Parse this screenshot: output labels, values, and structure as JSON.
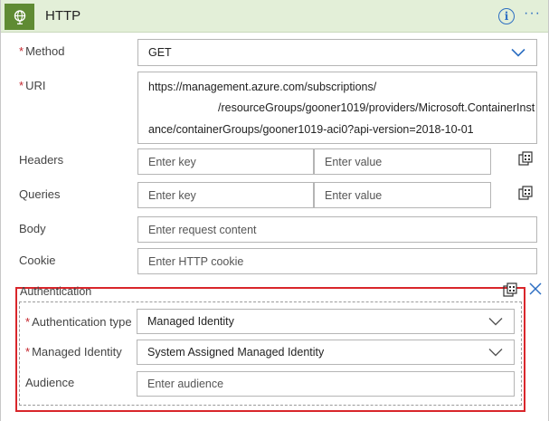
{
  "header": {
    "title": "HTTP",
    "info_glyph": "i",
    "more_glyph": "···",
    "icon": "globe-icon",
    "accent_color": "#5f8b33"
  },
  "form": {
    "method": {
      "label": "Method",
      "value": "GET"
    },
    "uri": {
      "label": "URI",
      "lines": [
        "https://management.azure.com/subscriptions/",
        "/resourceGroups/gooner1019/providers/Microsoft.ContainerInst",
        "ance/containerGroups/gooner1019-aci0?api-version=2018-10-01"
      ]
    },
    "headers": {
      "label": "Headers",
      "key_placeholder": "Enter key",
      "value_placeholder": "Enter value"
    },
    "queries": {
      "label": "Queries",
      "key_placeholder": "Enter key",
      "value_placeholder": "Enter value"
    },
    "body": {
      "label": "Body",
      "placeholder": "Enter request content"
    },
    "cookie": {
      "label": "Cookie",
      "placeholder": "Enter HTTP cookie"
    }
  },
  "authentication": {
    "section_label": "Authentication",
    "type": {
      "label": "Authentication type",
      "value": "Managed Identity"
    },
    "identity": {
      "label": "Managed Identity",
      "value": "System Assigned Managed Identity"
    },
    "audience": {
      "label": "Audience",
      "placeholder": "Enter audience"
    },
    "highlight_color": "#d9262b"
  },
  "required_marker": "*"
}
